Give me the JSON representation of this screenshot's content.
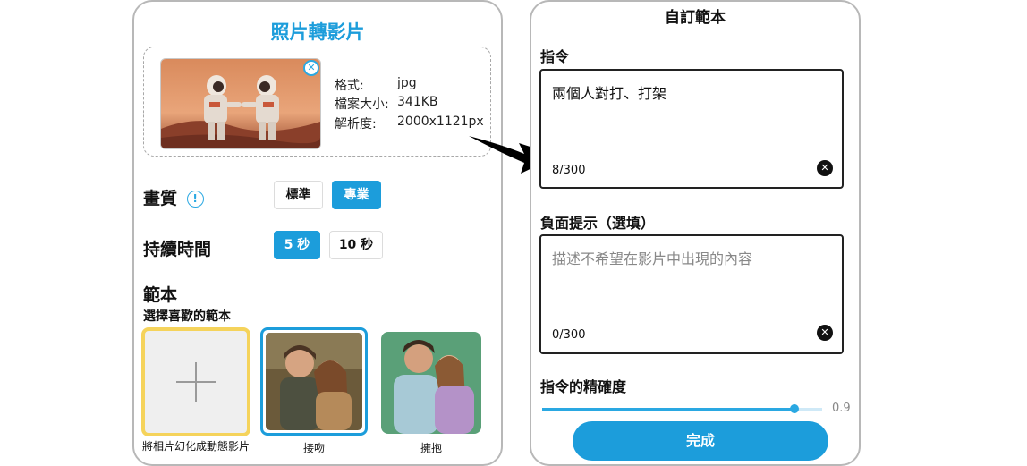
{
  "left": {
    "title": "照片轉影片",
    "file": {
      "format_label": "格式:",
      "format_value": "jpg",
      "size_label": "檔案大小:",
      "size_value": "341KB",
      "resolution_label": "解析度:",
      "resolution_value": "2000x1121px",
      "remove_icon": "close-circle-icon"
    },
    "quality": {
      "label": "畫質",
      "info_icon": "info-icon",
      "info_glyph": "!",
      "options": [
        "標準",
        "專業"
      ],
      "selected": "專業"
    },
    "duration": {
      "label": "持續時間",
      "options": [
        "5 秒",
        "10 秒"
      ],
      "selected": "5 秒"
    },
    "template": {
      "title": "範本",
      "subtitle": "選擇喜歡的範本",
      "items": [
        {
          "label": "將相片幻化成動態影片",
          "type": "add",
          "icon": "plus-icon"
        },
        {
          "label": "接吻",
          "type": "image",
          "selected": true
        },
        {
          "label": "擁抱",
          "type": "image"
        }
      ]
    }
  },
  "right": {
    "title": "自訂範本",
    "prompt": {
      "label": "指令",
      "value": "兩個人對打、打架",
      "count": "8/300",
      "clear_icon": "clear-circle-icon"
    },
    "negative": {
      "label": "負面提示（選填）",
      "placeholder": "描述不希望在影片中出現的內容",
      "count": "0/300",
      "clear_icon": "clear-circle-icon"
    },
    "precision": {
      "label": "指令的精確度",
      "value": "0.9",
      "fraction": 0.9
    },
    "done_label": "完成"
  },
  "colors": {
    "accent": "#1c9ddb",
    "template_highlight": "#f5d35b",
    "selected_border": "#1c9ddb"
  },
  "connector": {
    "icon": "curved-arrow-icon"
  }
}
